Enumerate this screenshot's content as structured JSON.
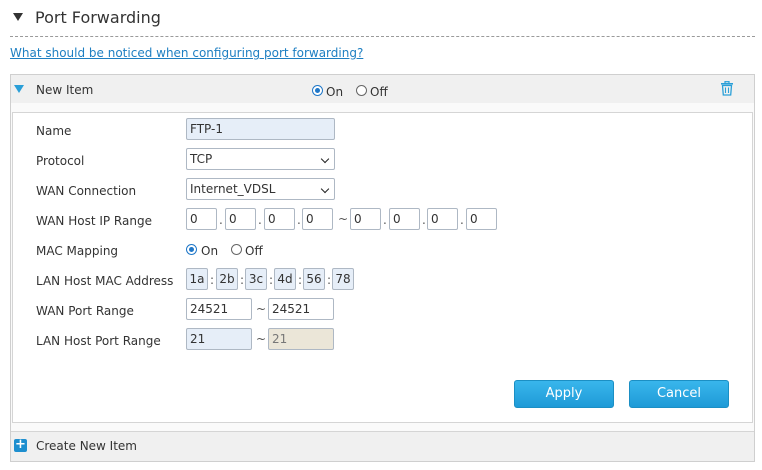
{
  "page": {
    "title": "Port Forwarding",
    "help_link": "What should be noticed when configuring port forwarding?"
  },
  "item": {
    "name": "New Item",
    "on_label": "On",
    "off_label": "Off",
    "enabled": "On"
  },
  "form": {
    "name": {
      "label": "Name",
      "value": "FTP-1"
    },
    "protocol": {
      "label": "Protocol",
      "value": "TCP"
    },
    "wan_connection": {
      "label": "WAN Connection",
      "value": "Internet_VDSL"
    },
    "wan_host_ip": {
      "label": "WAN Host IP Range",
      "start": [
        "0",
        "0",
        "0",
        "0"
      ],
      "end": [
        "0",
        "0",
        "0",
        "0"
      ]
    },
    "mac_mapping": {
      "label": "MAC Mapping",
      "on_label": "On",
      "off_label": "Off",
      "selected": "On"
    },
    "lan_host_mac": {
      "label": "LAN Host MAC Address",
      "octets": [
        "1a",
        "2b",
        "3c",
        "4d",
        "56",
        "78"
      ]
    },
    "wan_port_range": {
      "label": "WAN Port Range",
      "start": "24521",
      "end": "24521"
    },
    "lan_host_port_range": {
      "label": "LAN Host Port Range",
      "start": "21",
      "end": "21"
    },
    "range_sep": "~",
    "dot": ".",
    "colon": ":"
  },
  "buttons": {
    "apply": "Apply",
    "cancel": "Cancel"
  },
  "footer": {
    "create_label": "Create New Item"
  },
  "colors": {
    "accent": "#1e9ad7",
    "link": "#1e7fc2"
  },
  "icons": {
    "collapse": "triangle-down-icon",
    "expand": "triangle-down-blue-icon",
    "delete": "trash-icon",
    "add": "plus-icon"
  }
}
